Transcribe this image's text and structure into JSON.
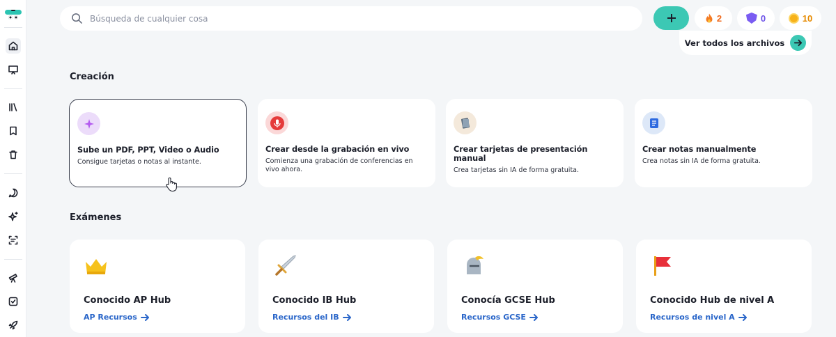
{
  "search": {
    "placeholder": "Búsqueda de cualquier cosa"
  },
  "stats": {
    "streak": "2",
    "level": "0",
    "coins": "10"
  },
  "files": {
    "label": "Ver todos los archivos"
  },
  "creation": {
    "title": "Creación",
    "cards": [
      {
        "title": "Sube un PDF, PPT, Video o Audio",
        "sub": "Consigue tarjetas o notas al instante."
      },
      {
        "title": "Crear desde la grabación en vivo",
        "sub": "Comienza una grabación de conferencias en vivo ahora."
      },
      {
        "title": "Crear tarjetas de presentación manual",
        "sub": "Crea tarjetas sin IA de forma gratuita."
      },
      {
        "title": "Crear notas manualmente",
        "sub": "Crea notas sin IA de forma gratuita."
      }
    ]
  },
  "exams": {
    "title": "Exámenes",
    "cards": [
      {
        "title": "Conocido AP Hub",
        "link": "AP Recursos"
      },
      {
        "title": "Conocido IB Hub",
        "link": "Recursos del IB"
      },
      {
        "title": "Conocía GCSE Hub",
        "link": "Recursos GCSE"
      },
      {
        "title": "Conocido Hub de nivel A",
        "link": "Recursos de nivel A"
      }
    ]
  },
  "colors": {
    "accent": "#3cc8b4",
    "link": "#2a66c9",
    "streak": "#f06a1d",
    "level": "#6b50e8",
    "coins": "#e68a00"
  }
}
